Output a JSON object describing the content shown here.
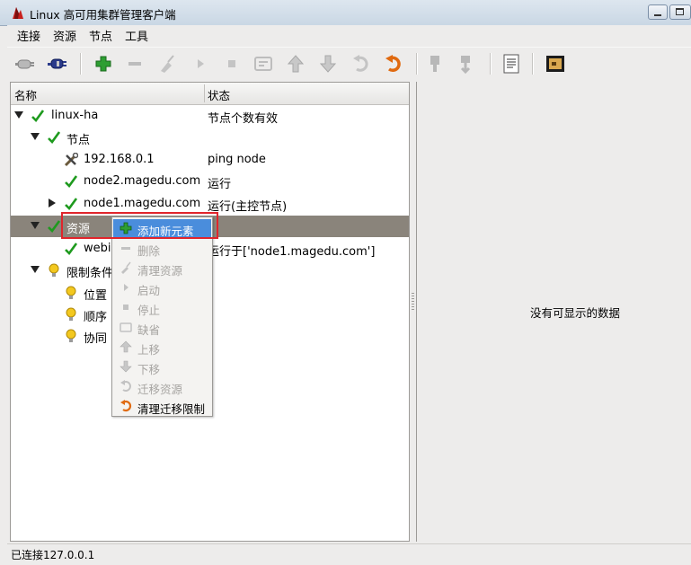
{
  "window": {
    "title": "Linux 高可用集群管理客户端"
  },
  "menubar": {
    "items": [
      "连接",
      "资源",
      "节点",
      "工具"
    ]
  },
  "tree": {
    "headers": {
      "name": "名称",
      "status": "状态"
    },
    "rows": [
      {
        "name": "linux-ha",
        "status": "节点个数有效",
        "icon": "check-icon",
        "toggle": "expanded"
      },
      {
        "name": "节点",
        "status": "",
        "icon": "check-icon",
        "toggle": "expanded"
      },
      {
        "name": "192.168.0.1",
        "status": "ping node",
        "icon": "tools-icon",
        "toggle": "none"
      },
      {
        "name": "node2.magedu.com",
        "status": "运行",
        "icon": "check-icon",
        "toggle": "none"
      },
      {
        "name": "node1.magedu.com",
        "status": "运行(主控节点)",
        "icon": "check-icon",
        "toggle": "collapsed"
      },
      {
        "name": "资源",
        "status": "",
        "icon": "check-icon",
        "toggle": "expanded"
      },
      {
        "name": "webi",
        "status": "运行于['node1.magedu.com']",
        "icon": "check-icon",
        "toggle": "none"
      },
      {
        "name": "限制条件",
        "status": "",
        "icon": "bulb-icon",
        "toggle": "expanded"
      },
      {
        "name": "位置",
        "status": "",
        "icon": "bulb-icon",
        "toggle": "none"
      },
      {
        "name": "顺序",
        "status": "",
        "icon": "bulb-icon",
        "toggle": "none"
      },
      {
        "name": "协同",
        "status": "",
        "icon": "bulb-icon",
        "toggle": "none"
      }
    ]
  },
  "context_menu": {
    "items": [
      {
        "label": "添加新元素",
        "enabled": true,
        "highlighted": true,
        "icon": "plus-icon"
      },
      {
        "label": "删除",
        "enabled": false,
        "icon": "minus-icon"
      },
      {
        "label": "清理资源",
        "enabled": false,
        "icon": "broom-icon"
      },
      {
        "label": "启动",
        "enabled": false,
        "icon": "play-icon"
      },
      {
        "label": "停止",
        "enabled": false,
        "icon": "stop-icon"
      },
      {
        "label": "缺省",
        "enabled": false,
        "icon": "default-icon"
      },
      {
        "label": "上移",
        "enabled": false,
        "icon": "arrow-up-icon"
      },
      {
        "label": "下移",
        "enabled": false,
        "icon": "arrow-down-icon"
      },
      {
        "label": "迁移资源",
        "enabled": false,
        "icon": "migrate-icon"
      },
      {
        "label": "清理迁移限制",
        "enabled": true,
        "icon": "undo-migrate-icon"
      }
    ]
  },
  "detail": {
    "empty_message": "没有可显示的数据"
  },
  "status": {
    "text": "已连接127.0.0.1"
  },
  "colors": {
    "selection": "#8a847b",
    "menu_highlight": "#4a8ddc",
    "annotation": "#e0252c",
    "check": "#1e9a1e"
  }
}
